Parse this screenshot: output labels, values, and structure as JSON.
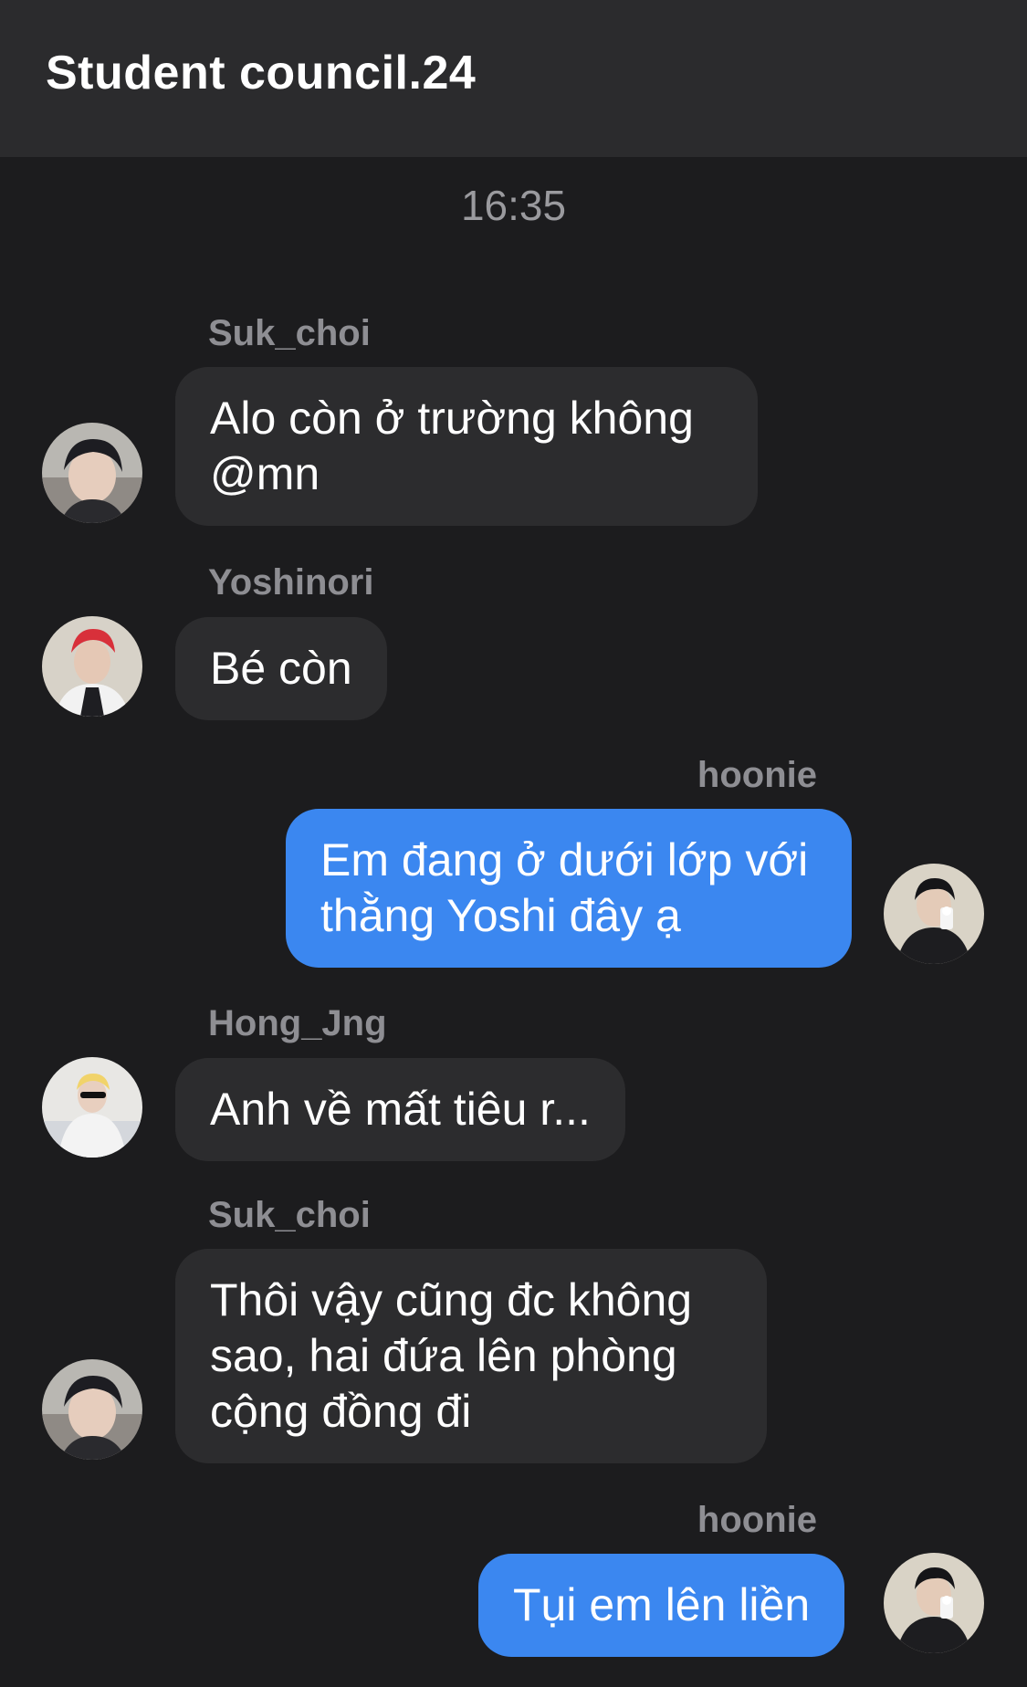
{
  "header": {
    "title": "Student council.24"
  },
  "timestamp": "16:35",
  "messages": [
    {
      "sender": "Suk_choi",
      "text": "Alo còn ở trường không @mn",
      "direction": "incoming",
      "avatar": "avatar-suk-choi"
    },
    {
      "sender": "Yoshinori",
      "text": "Bé còn",
      "direction": "incoming",
      "avatar": "avatar-yoshinori"
    },
    {
      "sender": "hoonie",
      "text": "Em đang ở dưới lớp với thằng Yoshi đây ạ",
      "direction": "outgoing",
      "avatar": "avatar-hoonie"
    },
    {
      "sender": "Hong_Jng",
      "text": "Anh về mất tiêu r...",
      "direction": "incoming",
      "avatar": "avatar-hong-jng"
    },
    {
      "sender": "Suk_choi",
      "text": "Thôi vậy cũng đc không sao, hai đứa lên phòng cộng đồng đi",
      "direction": "incoming",
      "avatar": "avatar-suk-choi"
    },
    {
      "sender": "hoonie",
      "text": "Tụi em lên liền",
      "direction": "outgoing",
      "avatar": "avatar-hoonie"
    }
  ],
  "colors": {
    "background": "#1c1c1e",
    "header": "#2b2b2d",
    "incoming_bubble": "#2c2c2e",
    "outgoing_bubble": "#3b87f0",
    "sender_name": "#8e8e93"
  }
}
